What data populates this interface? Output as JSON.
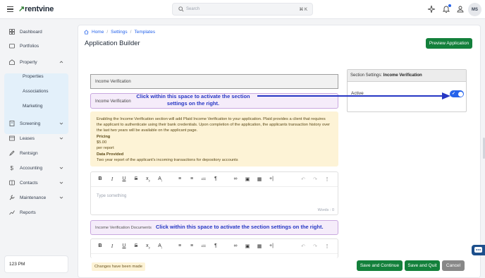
{
  "topbar": {
    "logo_mark": "↗",
    "logo_text": "rentvine",
    "search_placeholder": "Search",
    "search_shortcut": "⌘ K",
    "avatar_initials": "MS"
  },
  "sidebar": {
    "items": {
      "dashboard": "Dashboard",
      "portfolios": "Portfolios",
      "property": "Property",
      "screening": "Screening",
      "leases": "Leases",
      "rentsign": "Rentsign",
      "accounting": "Accounting",
      "contacts": "Contacts",
      "maintenance": "Maintenance",
      "reports": "Reports"
    },
    "property_sub": [
      "Properties",
      "Associations",
      "Marketing"
    ],
    "time": "123 PM"
  },
  "breadcrumb": [
    "Home",
    "Settings",
    "Templates"
  ],
  "page_title": "Application Builder",
  "preview_button": "Preview Application",
  "section": {
    "title": "Income Verification",
    "active_label": "Income Verification",
    "callout_top": "Click within this space to activate the section settings on the right.",
    "info_text": "Enabling the Income Verification section will add Plaid Income Verification to your application. Plaid provides a client that requires the applicant to authenticate using their bank credentials. Upon completion of the application, the applicants transaction history over the last two years will be available on the applicant page.",
    "pricing_label": "Pricing",
    "price": "$5.00",
    "per": "per report",
    "data_provided_label": "Data Provided",
    "data_provided_text": "Two year report of the applicant's incoming transactions for depository accounts"
  },
  "editor": {
    "placeholder": "Type something",
    "words": "Words : 0"
  },
  "docs": {
    "label": "Income Verification Documents",
    "callout": "Click within this space to activate the section settings on the right."
  },
  "settings_panel": {
    "title_prefix": "Section Settings:",
    "title_section": "Income Verification",
    "active_label": "Active",
    "active_on": true
  },
  "footer": {
    "changes_badge": "Changes have been made",
    "save_continue": "Save and Continue",
    "save_quit": "Save and Quit",
    "cancel": "Cancel"
  },
  "colors": {
    "brand_green": "#13803b",
    "callout_blue": "#2637c4",
    "toggle_blue": "#2563eb"
  }
}
